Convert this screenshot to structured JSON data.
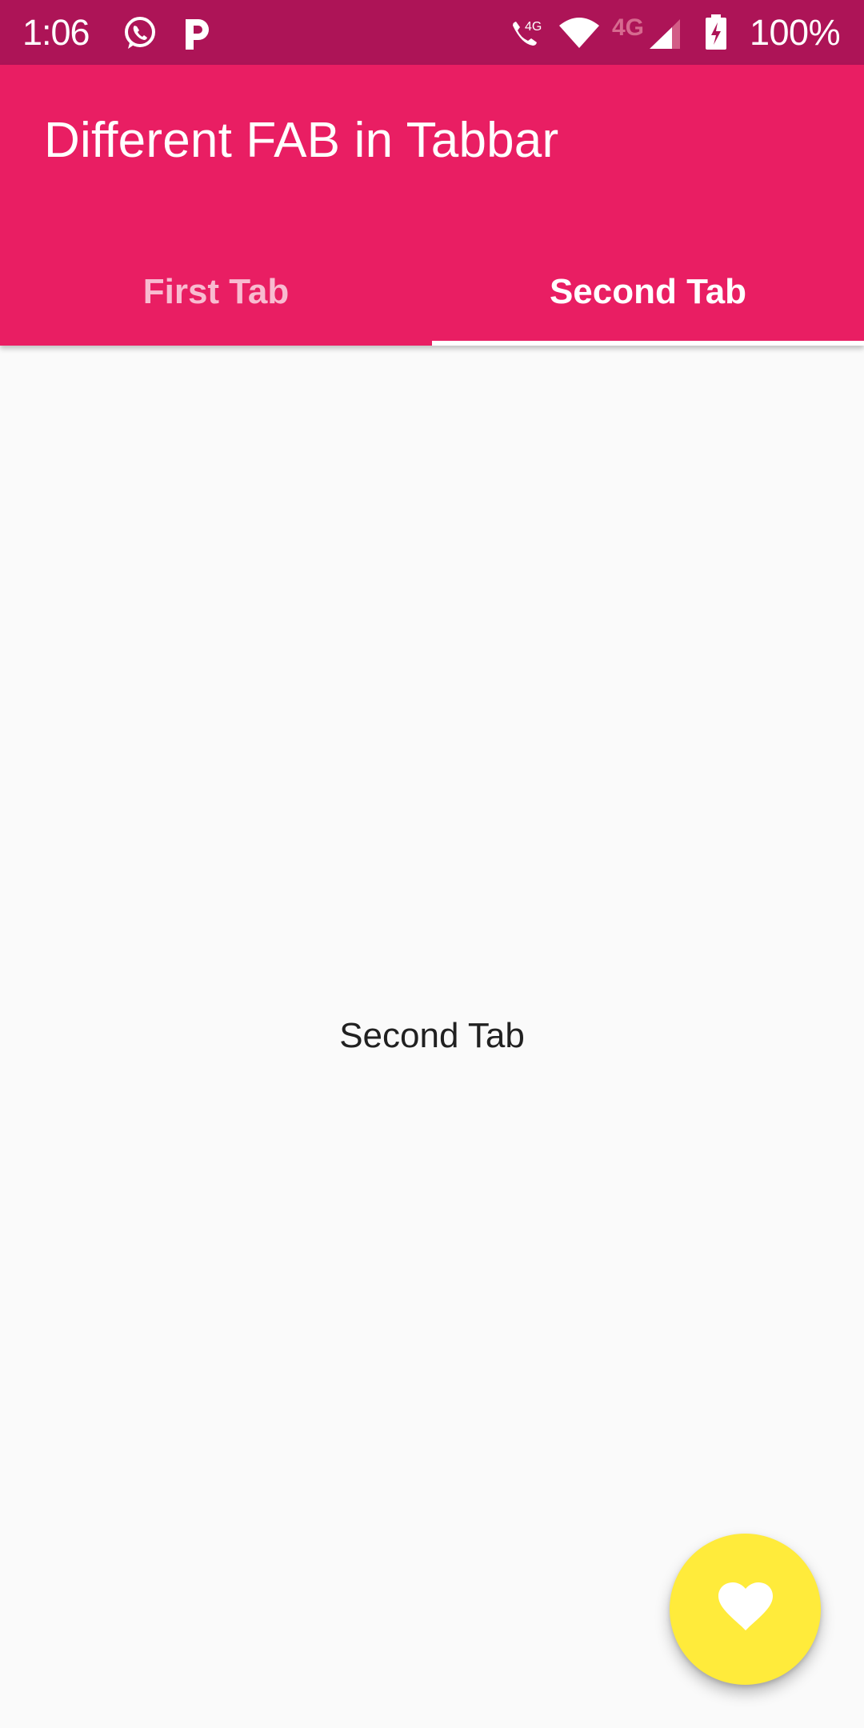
{
  "status_bar": {
    "time": "1:06",
    "left_icons": [
      "whatsapp-icon",
      "parking-p-icon"
    ],
    "right_icons": [
      "volte-call-4g-icon",
      "wifi-icon",
      "mobile-data-4g-icon",
      "cell-signal-icon",
      "battery-charging-icon"
    ],
    "call_network_label": "4G",
    "data_network_label": "4G",
    "battery_percent": "100%"
  },
  "app_bar": {
    "title": "Different FAB in Tabbar",
    "color": "#e91e63",
    "status_color": "#ad1457"
  },
  "tabs": [
    {
      "label": "First Tab",
      "selected": false
    },
    {
      "label": "Second Tab",
      "selected": true
    }
  ],
  "content": {
    "text": "Second Tab"
  },
  "fab": {
    "icon": "heart-icon",
    "color": "#ffeb3b"
  }
}
